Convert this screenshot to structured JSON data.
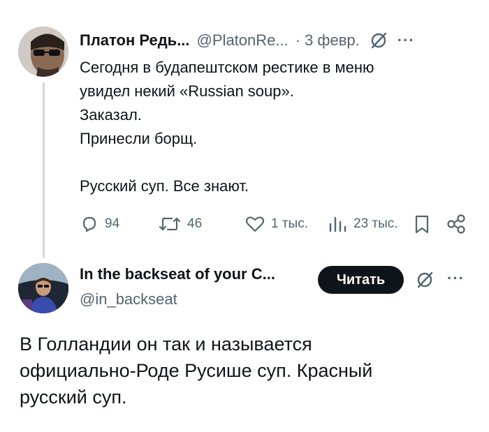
{
  "tweet1": {
    "author_name": "Платон Редь...",
    "handle": "@PlatonRe...",
    "separator": "·",
    "date": "3 февр.",
    "more_label": "···",
    "lines": [
      "Сегодня в будапештском рестике в меню",
      "увидел некий «Russian soup».",
      "Заказал.",
      "Принесли борщ.",
      "",
      "Русский суп. Все знают."
    ],
    "actions": {
      "replies": "94",
      "reposts": "46",
      "likes": "1 тыс.",
      "views": "23 тыс."
    },
    "icons": [
      "grok-icon",
      "reply-icon",
      "repost-icon",
      "like-icon",
      "views-icon",
      "bookmark-icon",
      "share-icon"
    ]
  },
  "tweet2": {
    "author_name": "In the backseat of your C...",
    "handle": "@in_backseat",
    "read_button": "Читать",
    "more_label": "···",
    "lines": [
      "В Голландии он так и называется",
      "официально-Роде Русише суп. Красный",
      "русский суп."
    ]
  },
  "colors": {
    "text": "#0f1419",
    "secondary": "#536471",
    "thread_line": "#cfd9de",
    "button_bg": "#0f1419",
    "button_text": "#ffffff"
  }
}
